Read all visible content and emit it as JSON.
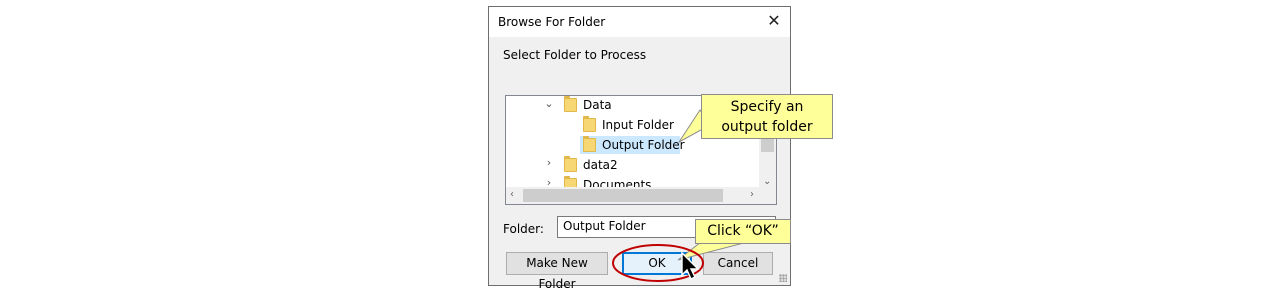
{
  "dialog": {
    "title": "Browse For Folder",
    "close_glyph": "✕",
    "prompt": "Select Folder to Process",
    "tree": [
      {
        "label": "Data",
        "expanded": true,
        "selected": false
      },
      {
        "label": "Input Folder",
        "selected": false
      },
      {
        "label": "Output Folder",
        "selected": true
      },
      {
        "label": "data2",
        "expanded": false,
        "selected": false
      },
      {
        "label": "Documents",
        "expanded": false,
        "selected": false
      }
    ],
    "folder_label": "Folder:",
    "folder_value": "Output Folder",
    "buttons": {
      "make_new": "Make New Folder",
      "ok": "OK",
      "cancel": "Cancel"
    }
  },
  "callouts": {
    "specify": {
      "line1": "Specify an",
      "line2": "output folder"
    },
    "click_ok": "Click “OK”"
  },
  "colors": {
    "callout_fill": "#ffff99",
    "highlight_ring": "#c00000",
    "selection": "#cce8ff",
    "ok_border": "#0078d7"
  }
}
